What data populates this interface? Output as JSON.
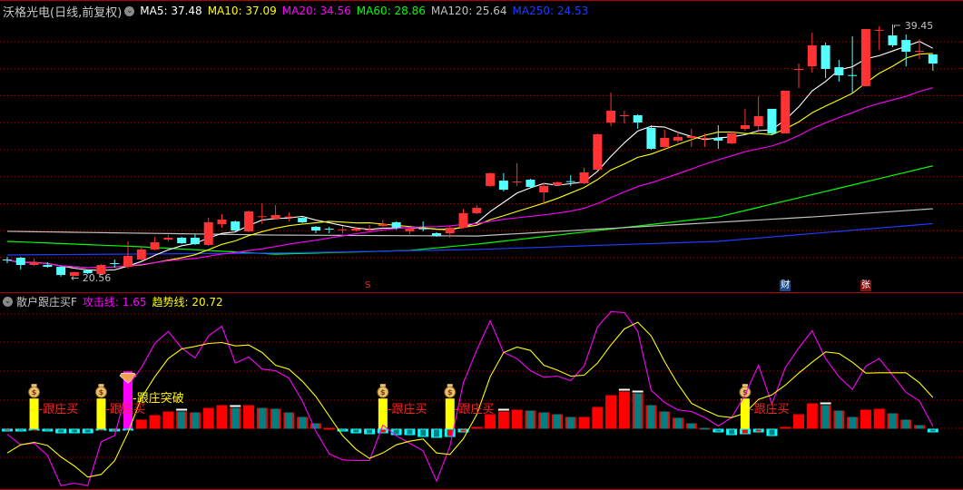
{
  "main_header": {
    "title": "沃格光电(日线,前复权)",
    "ma": [
      {
        "label": "MA5: 37.48",
        "color": "#ffffff"
      },
      {
        "label": "MA10: 37.09",
        "color": "#ffff00"
      },
      {
        "label": "MA20: 34.56",
        "color": "#ff00ff"
      },
      {
        "label": "MA60: 28.86",
        "color": "#00ff00"
      },
      {
        "label": "MA120: 25.64",
        "color": "#c0c0c0"
      },
      {
        "label": "MA250: 24.53",
        "color": "#1e3cff"
      }
    ]
  },
  "sub_header": {
    "title": "散户跟庄买F",
    "attack": {
      "label": "攻击线: 1.65",
      "color": "#ff00ff"
    },
    "trend": {
      "label": "趋势线: 20.72",
      "color": "#ffff00"
    }
  },
  "annotations": {
    "low_label": "20.56",
    "high_label": "39.45"
  },
  "events": [
    {
      "index": 27,
      "text": "S",
      "color": "#ff2020",
      "bg": "none"
    },
    {
      "index": 58,
      "text": "财",
      "color": "#ffffff",
      "bg": "#1a4a8a"
    },
    {
      "index": 64,
      "text": "张",
      "color": "#ffffff",
      "bg": "#8a1010"
    }
  ],
  "chart_data": [
    {
      "type": "candlestick",
      "title": "沃格光电 日线",
      "ylim": [
        20.3,
        40.2
      ],
      "ohlc": [
        [
          21.84,
          22.04,
          21.57,
          21.8
        ],
        [
          21.97,
          22.04,
          21.09,
          21.43
        ],
        [
          21.43,
          21.91,
          21.36,
          21.63
        ],
        [
          21.43,
          21.63,
          21.22,
          21.29
        ],
        [
          21.29,
          21.36,
          20.56,
          20.68
        ],
        [
          20.61,
          20.95,
          20.6,
          20.89
        ],
        [
          21.02,
          21.09,
          20.75,
          20.82
        ],
        [
          20.75,
          21.5,
          20.68,
          21.43
        ],
        [
          21.57,
          21.84,
          21.22,
          21.5
        ],
        [
          21.29,
          23.2,
          21.16,
          22.11
        ],
        [
          21.84,
          22.79,
          21.77,
          22.59
        ],
        [
          22.59,
          23.54,
          22.52,
          23.13
        ],
        [
          23.33,
          23.67,
          23.2,
          23.47
        ],
        [
          23.47,
          23.54,
          22.99,
          23.06
        ],
        [
          23.47,
          23.74,
          22.93,
          22.99
        ],
        [
          22.93,
          24.97,
          22.86,
          24.63
        ],
        [
          24.49,
          25.24,
          24.22,
          24.83
        ],
        [
          24.69,
          24.76,
          23.95,
          24.01
        ],
        [
          23.95,
          25.51,
          23.88,
          25.44
        ],
        [
          25.03,
          26.05,
          24.49,
          25.08
        ],
        [
          24.9,
          25.92,
          24.83,
          25.17
        ],
        [
          25.0,
          25.37,
          24.69,
          25.06
        ],
        [
          24.96,
          25.1,
          24.56,
          24.63
        ],
        [
          24.29,
          24.35,
          23.81,
          24.01
        ],
        [
          24.15,
          24.29,
          23.81,
          24.12
        ],
        [
          24.06,
          24.35,
          23.81,
          24.1
        ],
        [
          24.01,
          24.29,
          23.95,
          24.15
        ],
        [
          24.06,
          24.42,
          23.95,
          24.09
        ],
        [
          24.35,
          24.83,
          24.29,
          24.49
        ],
        [
          24.63,
          24.69,
          24.08,
          24.22
        ],
        [
          23.95,
          24.29,
          23.74,
          24.15
        ],
        [
          24.17,
          24.69,
          23.95,
          24.12
        ],
        [
          23.81,
          23.88,
          23.54,
          23.61
        ],
        [
          23.81,
          24.35,
          23.47,
          24.22
        ],
        [
          24.22,
          25.64,
          24.15,
          25.31
        ],
        [
          25.31,
          25.92,
          25.24,
          25.71
        ],
        [
          27.35,
          28.37,
          27.28,
          28.3
        ],
        [
          27.75,
          28.3,
          26.94,
          27.07
        ],
        [
          27.65,
          29.05,
          27.35,
          27.69
        ],
        [
          27.82,
          27.89,
          27.21,
          27.28
        ],
        [
          26.87,
          27.55,
          26.05,
          27.35
        ],
        [
          27.41,
          27.69,
          27.35,
          27.62
        ],
        [
          27.71,
          28.16,
          27.35,
          27.68
        ],
        [
          27.55,
          28.71,
          27.48,
          28.37
        ],
        [
          28.57,
          31.29,
          28.5,
          31.22
        ],
        [
          32.1,
          34.35,
          31.83,
          32.99
        ],
        [
          32.62,
          32.99,
          32.04,
          32.65
        ],
        [
          32.65,
          32.72,
          31.63,
          32.1
        ],
        [
          31.7,
          31.9,
          30.07,
          30.13
        ],
        [
          30.27,
          31.56,
          30.2,
          30.95
        ],
        [
          30.75,
          31.42,
          30.61,
          31.02
        ],
        [
          30.95,
          31.63,
          30.27,
          31.09
        ],
        [
          30.88,
          31.29,
          30.27,
          30.95
        ],
        [
          30.95,
          31.9,
          30.13,
          30.75
        ],
        [
          30.54,
          31.42,
          30.47,
          31.29
        ],
        [
          31.63,
          33.13,
          31.49,
          31.9
        ],
        [
          31.83,
          34.08,
          31.56,
          32.58
        ],
        [
          33.13,
          33.13,
          31.22,
          31.29
        ],
        [
          31.29,
          34.49,
          31.29,
          34.49
        ],
        [
          36.08,
          36.52,
          34.69,
          36.12
        ],
        [
          36.32,
          38.84,
          35.85,
          37.89
        ],
        [
          37.89,
          38.09,
          35.44,
          36.12
        ],
        [
          36.25,
          36.8,
          35.17,
          35.64
        ],
        [
          35.66,
          38.56,
          34.28,
          35.64
        ],
        [
          34.83,
          39.11,
          34.83,
          39.11
        ],
        [
          39.02,
          39.31,
          37.55,
          39.05
        ],
        [
          38.63,
          39.45,
          37.75,
          37.89
        ],
        [
          38.29,
          38.7,
          36.32,
          37.41
        ],
        [
          37.45,
          38.36,
          36.86,
          37.48
        ],
        [
          37.21,
          37.21,
          35.98,
          36.52
        ]
      ],
      "ma_computed": [
        {
          "name": "MA5",
          "n": 5,
          "color": "#ffffff"
        },
        {
          "name": "MA10",
          "n": 10,
          "color": "#ffff00"
        },
        {
          "name": "MA20",
          "n": 20,
          "color": "#ff00ff"
        }
      ],
      "ma_sampled": [
        {
          "name": "MA60",
          "color": "#00ff00",
          "points": [
            [
              0,
              23.2
            ],
            [
              10,
              22.79
            ],
            [
              20,
              22.24
            ],
            [
              30,
              22.52
            ],
            [
              35,
              22.99
            ],
            [
              53,
              25.03
            ],
            [
              69,
              28.86
            ]
          ]
        },
        {
          "name": "MA120",
          "color": "#c0c0c0",
          "points": [
            [
              0,
              23.95
            ],
            [
              20,
              23.67
            ],
            [
              35,
              23.6
            ],
            [
              60,
              25.03
            ],
            [
              69,
              25.64
            ]
          ]
        },
        {
          "name": "MA250",
          "color": "#1e3cff",
          "points": [
            [
              0,
              22.18
            ],
            [
              20,
              22.32
            ],
            [
              35,
              22.59
            ],
            [
              53,
              23.2
            ],
            [
              69,
              24.53
            ]
          ]
        }
      ]
    },
    {
      "type": "bar+line",
      "title": "散户跟庄买F",
      "ylim": [
        -40,
        85
      ],
      "bars": [
        [
          -1.8,
          "negred"
        ],
        [
          -1.8,
          "neg"
        ],
        [
          -1.2,
          "negred"
        ],
        [
          -1.8,
          "neg"
        ],
        [
          -3,
          "neg"
        ],
        [
          -3,
          "neg"
        ],
        [
          -3,
          "neg"
        ],
        [
          -1.2,
          "negred"
        ],
        [
          -1.8,
          "negred"
        ],
        [
          -1.2,
          "neg"
        ],
        [
          6,
          "red"
        ],
        [
          9,
          "red"
        ],
        [
          11.4,
          "red"
        ],
        [
          11.4,
          "teal"
        ],
        [
          10.8,
          "teal"
        ],
        [
          13.8,
          "red"
        ],
        [
          15.6,
          "red"
        ],
        [
          13.8,
          "teal"
        ],
        [
          15.6,
          "red"
        ],
        [
          13.8,
          "teal"
        ],
        [
          13.2,
          "teal"
        ],
        [
          10.8,
          "teal"
        ],
        [
          7.8,
          "teal"
        ],
        [
          3.6,
          "teal"
        ],
        [
          0.6,
          "red"
        ],
        [
          -1.8,
          "neg"
        ],
        [
          -3,
          "neg"
        ],
        [
          -3.6,
          "neg"
        ],
        [
          -3,
          "negred"
        ],
        [
          -4.2,
          "neg"
        ],
        [
          -4.2,
          "neg"
        ],
        [
          -5.4,
          "neg"
        ],
        [
          -6,
          "neg"
        ],
        [
          -5.4,
          "negred"
        ],
        [
          -2.4,
          "negred"
        ],
        [
          1.2,
          "red"
        ],
        [
          9.6,
          "red"
        ],
        [
          11.4,
          "red"
        ],
        [
          12.6,
          "red"
        ],
        [
          12,
          "teal"
        ],
        [
          10.8,
          "teal"
        ],
        [
          9.6,
          "teal"
        ],
        [
          7.8,
          "teal"
        ],
        [
          7.8,
          "red"
        ],
        [
          14.4,
          "red"
        ],
        [
          22.2,
          "red"
        ],
        [
          24.6,
          "red"
        ],
        [
          23.4,
          "teal"
        ],
        [
          15.6,
          "teal"
        ],
        [
          11.4,
          "teal"
        ],
        [
          7.2,
          "teal"
        ],
        [
          3.6,
          "teal"
        ],
        [
          0.6,
          "teal"
        ],
        [
          -2.4,
          "neg"
        ],
        [
          -4.2,
          "neg"
        ],
        [
          -3.6,
          "negred"
        ],
        [
          -2.4,
          "negred"
        ],
        [
          -4.8,
          "neg"
        ],
        [
          1.2,
          "red"
        ],
        [
          9.6,
          "red"
        ],
        [
          16.8,
          "red"
        ],
        [
          15.6,
          "teal"
        ],
        [
          12,
          "teal"
        ],
        [
          7.8,
          "teal"
        ],
        [
          12.6,
          "red"
        ],
        [
          13.2,
          "red"
        ],
        [
          10.2,
          "teal"
        ],
        [
          6,
          "teal"
        ],
        [
          2.4,
          "teal"
        ],
        [
          -2.4,
          "neg"
        ]
      ],
      "bar_caps": [
        13,
        17,
        37,
        46,
        47,
        61
      ],
      "series": [
        {
          "name": "攻击线",
          "color": "#ff00ff",
          "values": [
            -3.6,
            -10.6,
            -9.6,
            -17.6,
            -37.6,
            -36,
            -37.6,
            -8.6,
            -4.6,
            28.4,
            40.4,
            56.4,
            64.4,
            53.4,
            46.8,
            61.4,
            67.8,
            43.4,
            47.4,
            39.4,
            38.4,
            33.4,
            18.4,
            -1.6,
            -16.6,
            -20.6,
            -21,
            -21,
            2.4,
            -4.6,
            -9.6,
            -14.6,
            -34.6,
            -11.6,
            30.4,
            52,
            71.4,
            50.4,
            46.4,
            38.4,
            34,
            34.8,
            31.8,
            41.4,
            67.4,
            77.4,
            76.8,
            64.4,
            25.4,
            17.4,
            12.4,
            11.4,
            7.4,
            1.8,
            7.4,
            22.4,
            42,
            16.4,
            40.4,
            53.4,
            64.8,
            46.4,
            34.4,
            26,
            41.4,
            46.4,
            35.4,
            24,
            18.4,
            1.65
          ]
        },
        {
          "name": "趋势线",
          "color": "#ffff00",
          "values": [
            -16,
            -10.6,
            -9,
            -11,
            -18.6,
            -24.6,
            -32,
            -30.2,
            -21.2,
            -2.6,
            20.4,
            34.4,
            46.4,
            52.8,
            54.4,
            56.4,
            57,
            54.8,
            55.4,
            50.4,
            42,
            39.4,
            31.4,
            21.4,
            8.4,
            -4.6,
            -13.6,
            -19.6,
            -16,
            -10.6,
            -8.2,
            -6.8,
            -16,
            -17,
            -6.6,
            9.4,
            34.4,
            50.4,
            54,
            51.8,
            42,
            38.8,
            34.8,
            35.4,
            43.4,
            55.4,
            66,
            70.4,
            61.4,
            44.4,
            29.4,
            16.8,
            12.4,
            8.4,
            7.4,
            10.4,
            19.4,
            22.4,
            28.8,
            36.8,
            44,
            50.8,
            49.8,
            44,
            36.8,
            37,
            37,
            37,
            30.4,
            20.72
          ]
        }
      ],
      "signals": [
        {
          "index": 2,
          "kind": "buy",
          "label": "跟庄买",
          "level": 20,
          "color": "#ffff00",
          "text_color": "#ff2020"
        },
        {
          "index": 7,
          "kind": "buy",
          "label": "跟庄买",
          "level": 20,
          "color": "#ffff00",
          "text_color": "#ff2020"
        },
        {
          "index": 9,
          "kind": "breakout",
          "label": "跟庄突破",
          "level": 38,
          "color": "#ff00ff",
          "text_color": "#ffff00"
        },
        {
          "index": 28,
          "kind": "buy",
          "label": "跟庄买",
          "level": 20,
          "color": "#ffff00",
          "text_color": "#ff2020"
        },
        {
          "index": 33,
          "kind": "buy",
          "label": "跟庄买",
          "level": 20,
          "color": "#ffff00",
          "text_color": "#ff2020"
        },
        {
          "index": 55,
          "kind": "buy",
          "label": "跟庄买",
          "level": 20,
          "color": "#ffff00",
          "text_color": "#ff2020"
        }
      ]
    }
  ]
}
